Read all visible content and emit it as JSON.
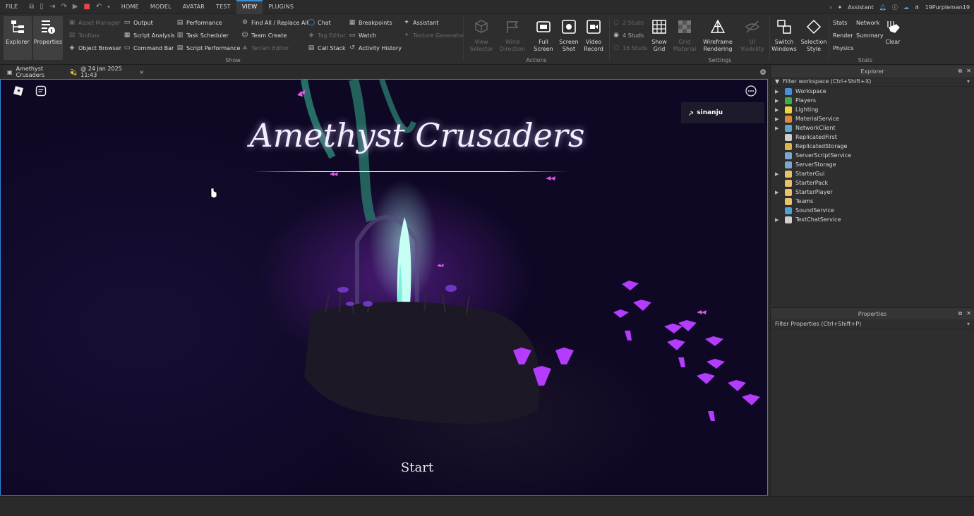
{
  "menubar": {
    "file": "FILE",
    "tabs": [
      {
        "label": "HOME",
        "active": false
      },
      {
        "label": "MODEL",
        "active": false
      },
      {
        "label": "AVATAR",
        "active": false
      },
      {
        "label": "TEST",
        "active": false
      },
      {
        "label": "VIEW",
        "active": true
      },
      {
        "label": "PLUGINS",
        "active": false
      }
    ],
    "assistant": "Assistant",
    "username": "19Purpleman19"
  },
  "ribbon": {
    "explorer": "Explorer",
    "properties": "Properties",
    "col1": [
      "Asset Manager",
      "Toolbox",
      "Object Browser"
    ],
    "col2": [
      "Output",
      "Script Analysis",
      "Command Bar"
    ],
    "col3": [
      "Performance",
      "Task Scheduler",
      "Script Performance"
    ],
    "col4": [
      "Find All / Replace All",
      "Team Create",
      "Terrain Editor"
    ],
    "col5": [
      "Chat",
      "Tag Editor",
      "Call Stack"
    ],
    "col6": [
      "Breakpoints",
      "Watch",
      "Activity History"
    ],
    "col7": [
      "Assistant",
      "Texture Generator"
    ],
    "group_show": "Show",
    "view_selector": [
      "View",
      "Selector"
    ],
    "wind_direction": [
      "Wind",
      "Direction"
    ],
    "full_screen": [
      "Full",
      "Screen"
    ],
    "screen_shot": [
      "Screen",
      "Shot"
    ],
    "video_record": [
      "Video",
      "Record"
    ],
    "group_actions": "Actions",
    "studs": [
      "2 Studs",
      "4 Studs",
      "16 Studs"
    ],
    "show_grid": [
      "Show",
      "Grid"
    ],
    "grid_material": [
      "Grid",
      "Material"
    ],
    "wireframe": [
      "Wireframe",
      "Rendering"
    ],
    "ui_visibility": "UI Visibility",
    "group_settings": "Settings",
    "switch_windows": [
      "Switch",
      "Windows"
    ],
    "selection_style": [
      "Selection",
      "Style"
    ],
    "stats_items": [
      "Stats",
      "Network",
      "Render",
      "Summary",
      "Physics"
    ],
    "clear": "Clear",
    "group_stats": "Stats"
  },
  "doc_tab": {
    "title": "Amethyst Crusaders",
    "emoji": "💫",
    "date": "@ 24 Jan 2025 11:43",
    "close": "×"
  },
  "game": {
    "title": "Amethyst Crusaders",
    "start": "Start",
    "player": "sinanju"
  },
  "explorer": {
    "title": "Explorer",
    "filter_placeholder": "Filter workspace (Ctrl+Shift+X)",
    "items": [
      {
        "label": "Workspace",
        "expandable": true,
        "color": "#4a90d9"
      },
      {
        "label": "Players",
        "expandable": true,
        "color": "#3fae49"
      },
      {
        "label": "Lighting",
        "expandable": true,
        "color": "#f2d43a"
      },
      {
        "label": "MaterialService",
        "expandable": true,
        "color": "#d98a3a"
      },
      {
        "label": "NetworkClient",
        "expandable": true,
        "color": "#5aa9c9"
      },
      {
        "label": "ReplicatedFirst",
        "expandable": false,
        "color": "#cfcfcf"
      },
      {
        "label": "ReplicatedStorage",
        "expandable": false,
        "color": "#e0b44a"
      },
      {
        "label": "ServerScriptService",
        "expandable": false,
        "color": "#7da6d1"
      },
      {
        "label": "ServerStorage",
        "expandable": false,
        "color": "#7da6d1"
      },
      {
        "label": "StarterGui",
        "expandable": true,
        "color": "#e6c36a"
      },
      {
        "label": "StarterPack",
        "expandable": false,
        "color": "#e6c36a"
      },
      {
        "label": "StarterPlayer",
        "expandable": true,
        "color": "#e6c36a"
      },
      {
        "label": "Teams",
        "expandable": false,
        "color": "#e6c36a"
      },
      {
        "label": "SoundService",
        "expandable": false,
        "color": "#4aa3d9"
      },
      {
        "label": "TextChatService",
        "expandable": true,
        "color": "#cfcfcf"
      }
    ]
  },
  "properties": {
    "title": "Properties",
    "filter_placeholder": "Filter Properties (Ctrl+Shift+P)"
  }
}
